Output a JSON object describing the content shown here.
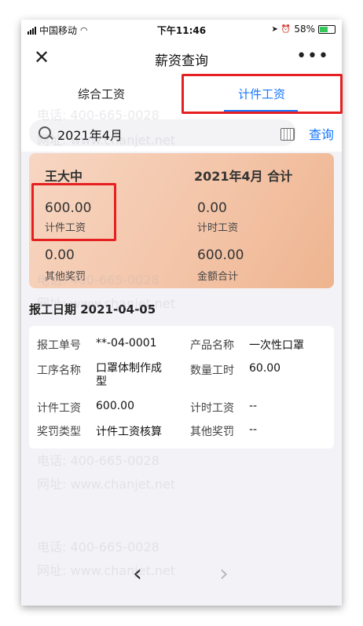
{
  "status_bar": {
    "carrier": "中国移动",
    "time": "下午11:46",
    "battery": "58%",
    "battery_level": 0.58
  },
  "nav": {
    "title": "薪资查询",
    "more": "•••"
  },
  "tabs": [
    {
      "label": "综合工资"
    },
    {
      "label": "计件工资"
    }
  ],
  "search": {
    "value": "2021年4月",
    "query_label": "查询"
  },
  "summary": {
    "name": "王大中",
    "month_total_label": "2021年4月 合计",
    "items": [
      {
        "value": "600.00",
        "label": "计件工资"
      },
      {
        "value": "0.00",
        "label": "计时工资"
      },
      {
        "value": "0.00",
        "label": "其他奖罚"
      },
      {
        "value": "600.00",
        "label": "金额合计"
      }
    ]
  },
  "report": {
    "date_label": "报工日期 2021-04-05",
    "fields": [
      {
        "label": "报工单号",
        "value": "**-04-0001"
      },
      {
        "label": "产品名称",
        "value": "一次性口罩"
      },
      {
        "label": "工序名称",
        "value": "口罩体制作成型"
      },
      {
        "label": "数量工时",
        "value": "60.00"
      },
      {
        "label": "计件工资",
        "value": "600.00"
      },
      {
        "label": "计时工资",
        "value": "--"
      },
      {
        "label": "奖罚类型",
        "value": "计件工资核算"
      },
      {
        "label": "其他奖罚",
        "value": "--"
      }
    ]
  },
  "pager": {
    "prev": "‹",
    "next": "›"
  },
  "watermark": {
    "phone": "电话: 400-665-0028",
    "site": "网址: www.chanjet.net"
  }
}
